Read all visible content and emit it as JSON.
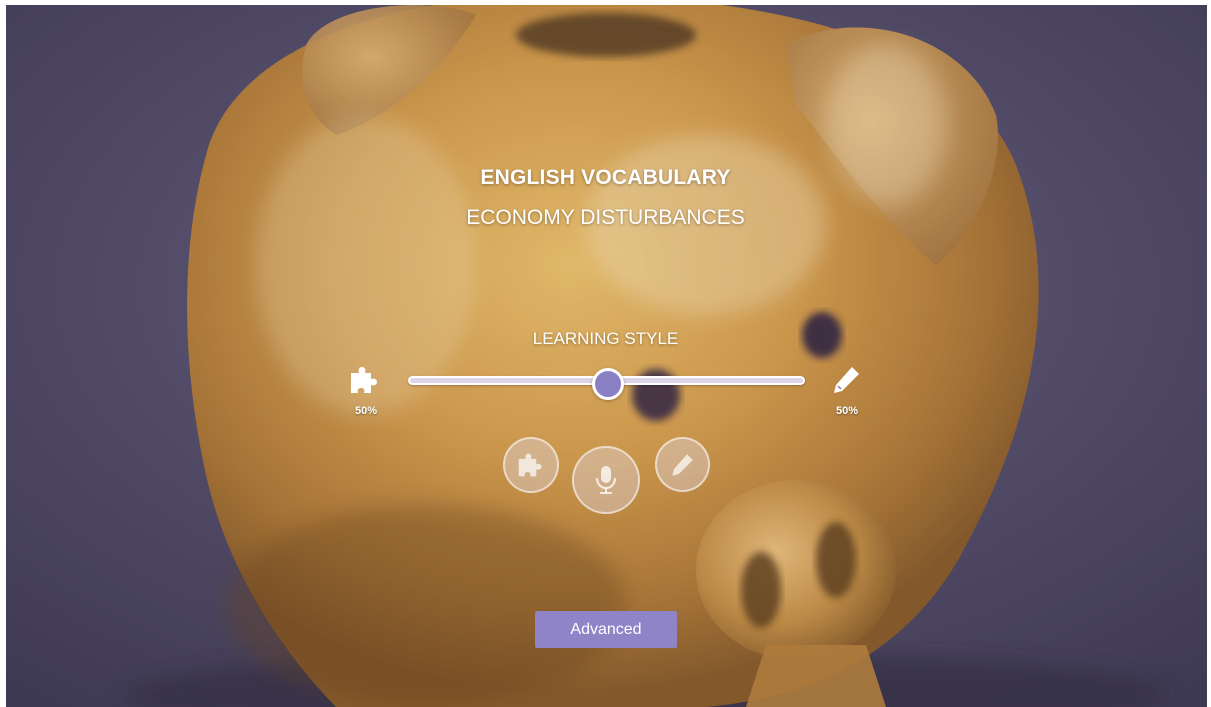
{
  "header": {
    "title": "ENGLISH VOCABULARY",
    "subtitle": "ECONOMY DISTURBANCES"
  },
  "learning_style": {
    "label": "LEARNING STYLE",
    "left_icon": "puzzle-icon",
    "left_percent": "50%",
    "right_icon": "pencil-icon",
    "right_percent": "50%",
    "slider_value": 0.5
  },
  "modes": [
    {
      "icon": "puzzle-icon"
    },
    {
      "icon": "microphone-icon"
    },
    {
      "icon": "pencil-icon"
    }
  ],
  "footer": {
    "advanced_label": "Advanced"
  },
  "colors": {
    "accent": "#8f84c8",
    "thumb": "#8a80c4",
    "text": "#ffffff"
  }
}
